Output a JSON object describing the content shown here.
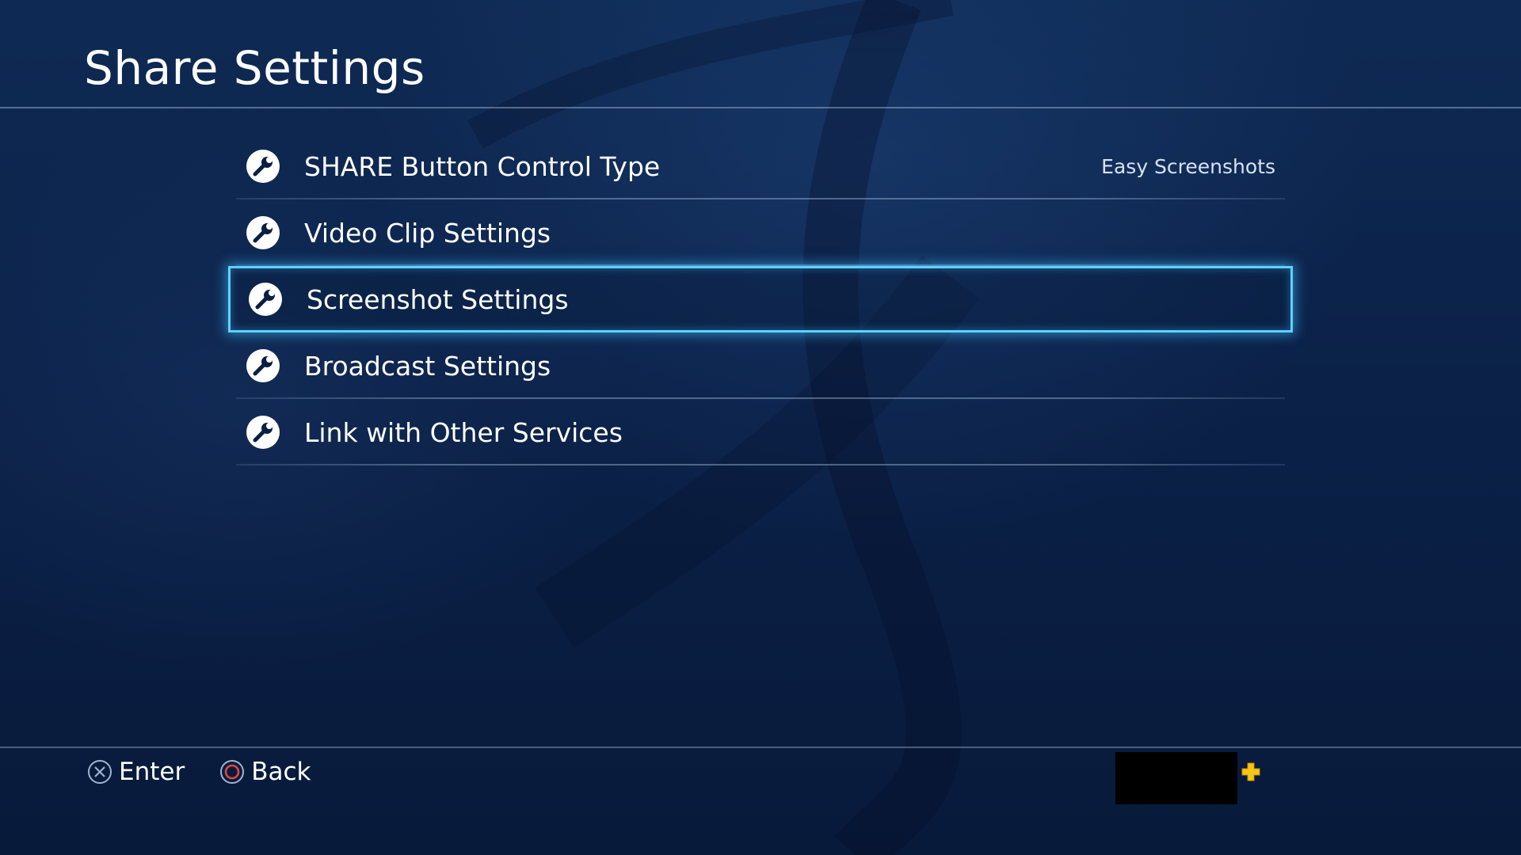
{
  "header": {
    "title": "Share Settings"
  },
  "menu": {
    "items": [
      {
        "label": "SHARE Button Control Type",
        "value": "Easy Screenshots",
        "icon": "wrench-icon"
      },
      {
        "label": "Video Clip Settings",
        "icon": "wrench-icon"
      },
      {
        "label": "Screenshot Settings",
        "icon": "wrench-icon",
        "selected": true
      },
      {
        "label": "Broadcast Settings",
        "icon": "wrench-icon"
      },
      {
        "label": "Link with Other Services",
        "icon": "wrench-icon"
      }
    ]
  },
  "footer": {
    "enter": {
      "label": "Enter",
      "icon": "cross-button-icon"
    },
    "back": {
      "label": "Back",
      "icon": "circle-button-icon"
    },
    "status_icon": "playstation-plus-icon"
  },
  "colors": {
    "accent": "#5fd1ff",
    "background": "#0b1f42",
    "plus": "#f5c518",
    "circle_button": "#e0463c"
  }
}
